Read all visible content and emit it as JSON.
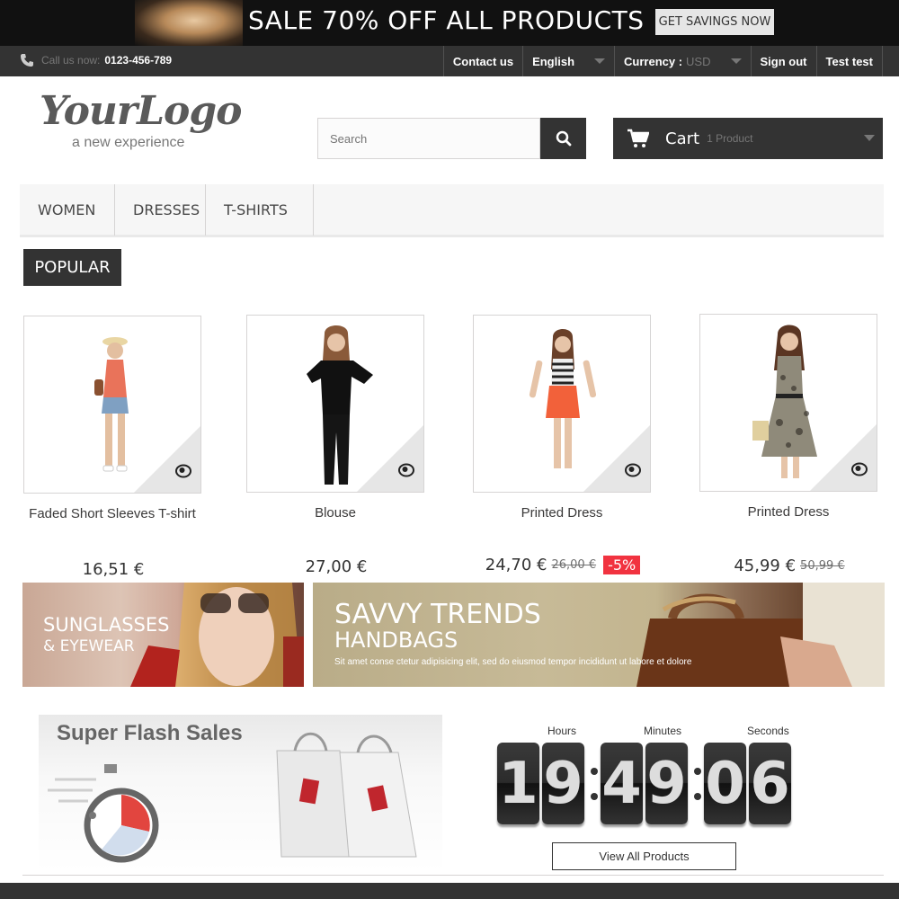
{
  "promo": {
    "text": "SALE 70% OFF ALL PRODUCTS",
    "button": "GET SAVINGS NOW"
  },
  "navbar": {
    "call_label": "Call us now:",
    "phone": "0123-456-789",
    "contact": "Contact us",
    "language": "English",
    "currency_label": "Currency :",
    "currency_value": "USD",
    "sign_out": "Sign out",
    "user": "Test test"
  },
  "header": {
    "logo_main": "YourLogo",
    "logo_sub": "a new experience",
    "search_placeholder": "Search",
    "cart_label": "Cart",
    "cart_count": "1 Product"
  },
  "menu": [
    "WOMEN",
    "DRESSES",
    "T-SHIRTS"
  ],
  "section_title": "POPULAR",
  "products": [
    {
      "name": "Faded Short Sleeves T-shirt",
      "price": "16,51 €",
      "old_price": "",
      "discount": ""
    },
    {
      "name": "Blouse",
      "price": "27,00 €",
      "old_price": "",
      "discount": ""
    },
    {
      "name": "Printed Dress",
      "price": "24,70 €",
      "old_price": "26,00 €",
      "discount": "-5%"
    },
    {
      "name": "Printed Dress",
      "price": "45,99 €",
      "old_price": "50,99 €",
      "discount": ""
    }
  ],
  "banners": {
    "left_line1": "SUNGLASSES",
    "left_line2": "& EYEWEAR",
    "right_line1": "SAVVY TRENDS",
    "right_line2": "HANDBAGS",
    "right_text": "Sit amet conse ctetur adipisicing elit, sed do eiusmod tempor incididunt ut labore et dolore"
  },
  "flash": {
    "title": "Super Flash Sales",
    "hours_label": "Hours",
    "minutes_label": "Minutes",
    "seconds_label": "Seconds",
    "h1": "1",
    "h2": "9",
    "m1": "4",
    "m2": "9",
    "s1": "0",
    "s2": "6",
    "view_all": "View All Products"
  },
  "colors": {
    "dark": "#333333",
    "discount": "#f13340",
    "menu_bg": "#f6f6f6"
  }
}
